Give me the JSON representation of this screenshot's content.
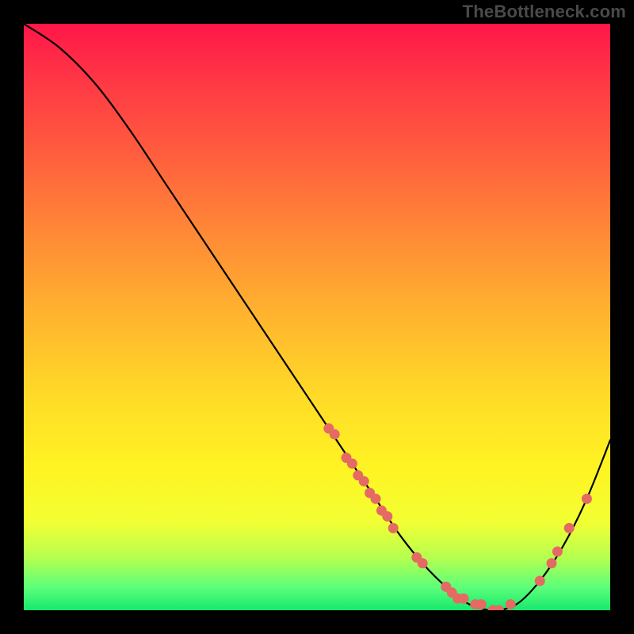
{
  "attribution": "TheBottleneck.com",
  "chart_data": {
    "type": "line",
    "title": "",
    "xlabel": "",
    "ylabel": "",
    "xlim": [
      0,
      100
    ],
    "ylim": [
      0,
      100
    ],
    "gradient_stops": [
      {
        "pct": 0,
        "color": "#ff1649"
      },
      {
        "pct": 8,
        "color": "#ff3246"
      },
      {
        "pct": 22,
        "color": "#ff5d3e"
      },
      {
        "pct": 36,
        "color": "#ff8a36"
      },
      {
        "pct": 50,
        "color": "#ffb52e"
      },
      {
        "pct": 64,
        "color": "#ffdc27"
      },
      {
        "pct": 76,
        "color": "#fff423"
      },
      {
        "pct": 85,
        "color": "#f2ff33"
      },
      {
        "pct": 91,
        "color": "#b6ff4f"
      },
      {
        "pct": 96,
        "color": "#5eff7a"
      },
      {
        "pct": 100,
        "color": "#17e86d"
      }
    ],
    "series": [
      {
        "name": "bottleneck-curve",
        "x": [
          0,
          6,
          12,
          18,
          24,
          30,
          36,
          42,
          48,
          52,
          56,
          60,
          64,
          68,
          72,
          76,
          80,
          84,
          88,
          92,
          96,
          100
        ],
        "y": [
          100,
          96,
          90,
          82,
          73,
          64,
          55,
          46,
          37,
          31,
          25,
          19,
          13,
          8,
          4,
          1,
          0,
          1,
          5,
          11,
          19,
          29
        ]
      }
    ],
    "dots": {
      "name": "measurement-points",
      "color": "#e46a63",
      "radius": 6.5,
      "points": [
        {
          "x": 52,
          "y": 31
        },
        {
          "x": 53,
          "y": 30
        },
        {
          "x": 55,
          "y": 26
        },
        {
          "x": 56,
          "y": 25
        },
        {
          "x": 57,
          "y": 23
        },
        {
          "x": 58,
          "y": 22
        },
        {
          "x": 59,
          "y": 20
        },
        {
          "x": 60,
          "y": 19
        },
        {
          "x": 61,
          "y": 17
        },
        {
          "x": 62,
          "y": 16
        },
        {
          "x": 63,
          "y": 14
        },
        {
          "x": 67,
          "y": 9
        },
        {
          "x": 68,
          "y": 8
        },
        {
          "x": 72,
          "y": 4
        },
        {
          "x": 73,
          "y": 3
        },
        {
          "x": 74,
          "y": 2
        },
        {
          "x": 75,
          "y": 2
        },
        {
          "x": 77,
          "y": 1
        },
        {
          "x": 78,
          "y": 1
        },
        {
          "x": 80,
          "y": 0
        },
        {
          "x": 81,
          "y": 0
        },
        {
          "x": 83,
          "y": 1
        },
        {
          "x": 88,
          "y": 5
        },
        {
          "x": 90,
          "y": 8
        },
        {
          "x": 91,
          "y": 10
        },
        {
          "x": 93,
          "y": 14
        },
        {
          "x": 96,
          "y": 19
        }
      ]
    }
  }
}
